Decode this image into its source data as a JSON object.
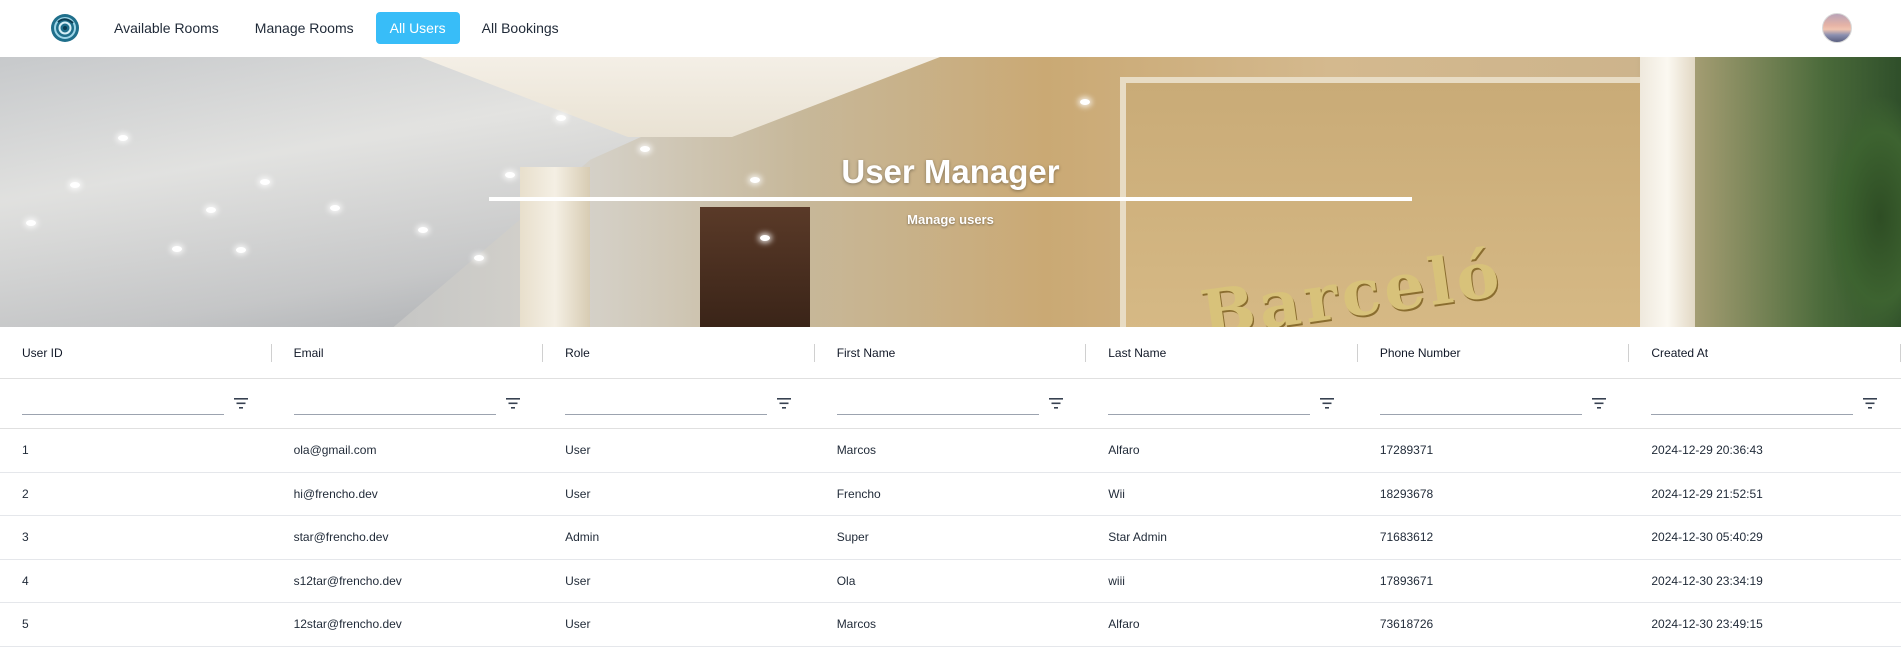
{
  "nav": {
    "links": [
      {
        "label": "Available Rooms",
        "active": false
      },
      {
        "label": "Manage Rooms",
        "active": false
      },
      {
        "label": "All Users",
        "active": true
      },
      {
        "label": "All Bookings",
        "active": false
      }
    ],
    "accent_color": "#38bdf8"
  },
  "hero": {
    "title": "User Manager",
    "subtitle": "Manage users",
    "sign_text": "Barceló"
  },
  "table": {
    "columns": [
      "User ID",
      "Email",
      "Role",
      "First Name",
      "Last Name",
      "Phone Number",
      "Created At"
    ],
    "filter_icon": "filter-icon",
    "rows": [
      [
        "1",
        "ola@gmail.com",
        "User",
        "Marcos",
        "Alfaro",
        "17289371",
        "2024-12-29 20:36:43"
      ],
      [
        "2",
        "hi@frencho.dev",
        "User",
        "Frencho",
        "Wii",
        "18293678",
        "2024-12-29 21:52:51"
      ],
      [
        "3",
        "star@frencho.dev",
        "Admin",
        "Super",
        "Star Admin",
        "71683612",
        "2024-12-30 05:40:29"
      ],
      [
        "4",
        "s12tar@frencho.dev",
        "User",
        "Ola",
        "wiii",
        "17893671",
        "2024-12-30 23:34:19"
      ],
      [
        "5",
        "12star@frencho.dev",
        "User",
        "Marcos",
        "Alfaro",
        "73618726",
        "2024-12-30 23:49:15"
      ]
    ]
  }
}
